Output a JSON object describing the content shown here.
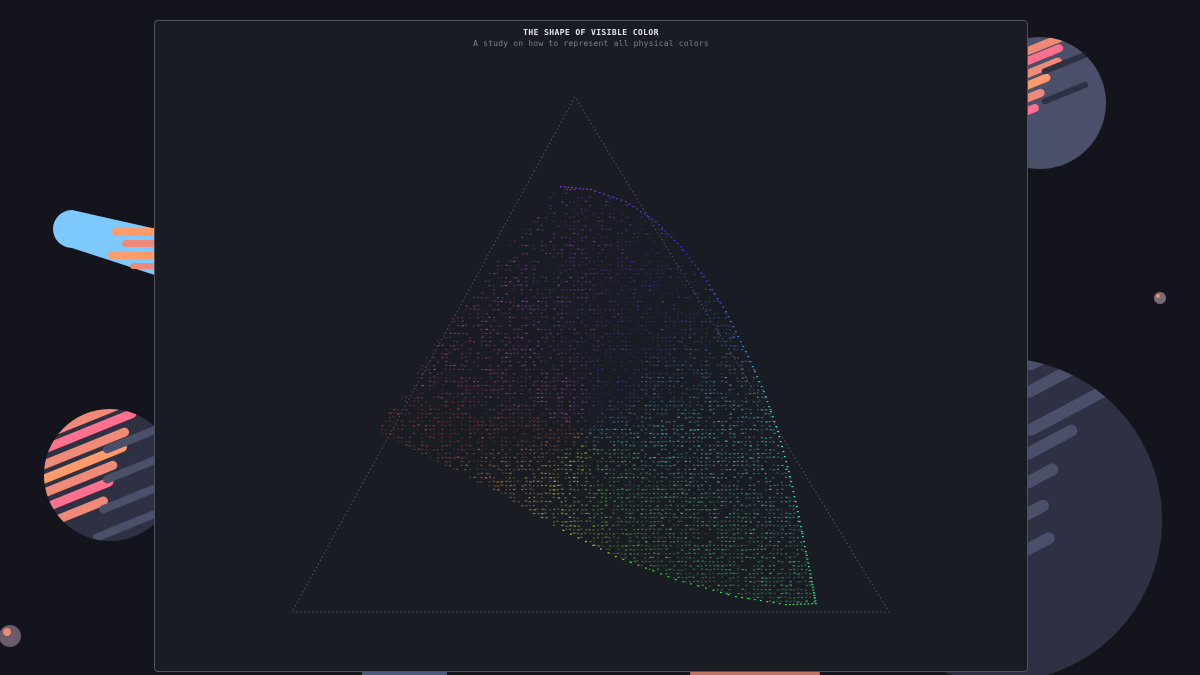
{
  "page": {
    "title": "THE SHAPE OF VISIBLE COLOR",
    "subtitle": "A study on how to represent all physical colors"
  },
  "colors": {
    "background": "#14151c",
    "panel": "#1a1c23",
    "panel_border": "#4c5262",
    "triangle_outline": "#5a6070",
    "planet_body": "#4a4f6a",
    "planet_shadow": "#2e3144",
    "stripe_salmon": "#f08a78",
    "stripe_pink": "#ff6f8e",
    "comet_blue": "#7cc8ff",
    "comet_orange": "#ff9a6a"
  },
  "decorations": [
    {
      "name": "comet",
      "icon": "comet-icon"
    },
    {
      "name": "planet-left",
      "icon": "striped-planet-icon"
    },
    {
      "name": "planet-top-right",
      "icon": "striped-planet-icon"
    },
    {
      "name": "planet-large-right",
      "icon": "striped-planet-icon"
    },
    {
      "name": "moon-small-right",
      "icon": "moon-icon"
    },
    {
      "name": "moon-small-left",
      "icon": "moon-icon"
    }
  ],
  "visualization": {
    "type": "chromaticity-triangle",
    "outline_icon": "dotted-triangle-icon",
    "fill_icon": "color-dot-cloud"
  }
}
